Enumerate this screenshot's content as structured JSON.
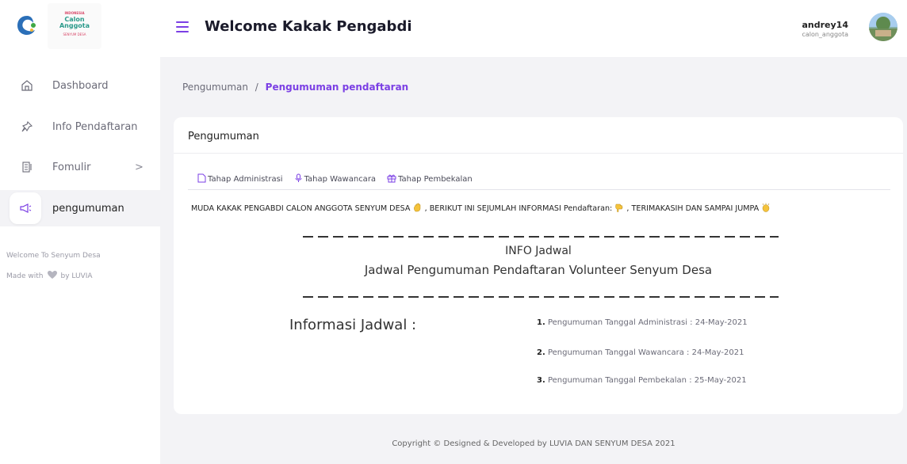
{
  "logo": {
    "line1": "INDONESIA",
    "line2a": "Calon",
    "line2b": "Anggota",
    "line3": "SENYUM DESA"
  },
  "header": {
    "title": "Welcome Kakak Pengabdi",
    "username": "andrey14",
    "role": "calon_anggota"
  },
  "sidebar": {
    "items": [
      {
        "label": "Dashboard",
        "icon": "home-icon"
      },
      {
        "label": "Info Pendaftaran",
        "icon": "pin-icon"
      },
      {
        "label": "Fomulir",
        "icon": "form-icon",
        "chevron": ">"
      },
      {
        "label": "pengumuman",
        "icon": "megaphone-icon",
        "active": true
      }
    ],
    "footer_line1": "Welcome To Senyum Desa",
    "footer_made": "Made with",
    "footer_by": "by LUVIA"
  },
  "breadcrumb": {
    "parent": "Pengumuman",
    "separator": "/",
    "current": "Pengumuman pendaftaran"
  },
  "card": {
    "title": "Pengumuman",
    "tabs": [
      {
        "label": "Tahap Administrasi",
        "icon": "file-icon"
      },
      {
        "label": "Tahap Wawancara",
        "icon": "mic-icon"
      },
      {
        "label": "Tahap Pembekalan",
        "icon": "gift-icon"
      }
    ],
    "intro_a": "MUDA KAKAK PENGABDI CALON ANGGOTA SENYUM DESA",
    "intro_b": ", BERIKUT INI SEJUMLAH INFORMASI Pendaftaran:",
    "intro_c": ", TERIMAKASIH DAN SAMPAI JUMPA",
    "info_title": "INFO Jadwal",
    "info_subtitle": "Jadwal Pengumuman Pendaftaran Volunteer Senyum Desa",
    "schedule_heading": "Informasi Jadwal :",
    "schedule": [
      {
        "num": "1.",
        "text": "Pengumuman Tanggal Administrasi : 24-May-2021"
      },
      {
        "num": "2.",
        "text": "Pengumuman Tanggal Wawancara : 24-May-2021"
      },
      {
        "num": "3.",
        "text": "Pengumuman Tanggal Pembekalan : 25-May-2021"
      }
    ]
  },
  "footer": {
    "copyright": "Copyright © Designed & Developed by LUVIA DAN SENYUM DESA 2021"
  },
  "colors": {
    "accent": "#7b3fe4",
    "background": "#f3f3f6"
  }
}
